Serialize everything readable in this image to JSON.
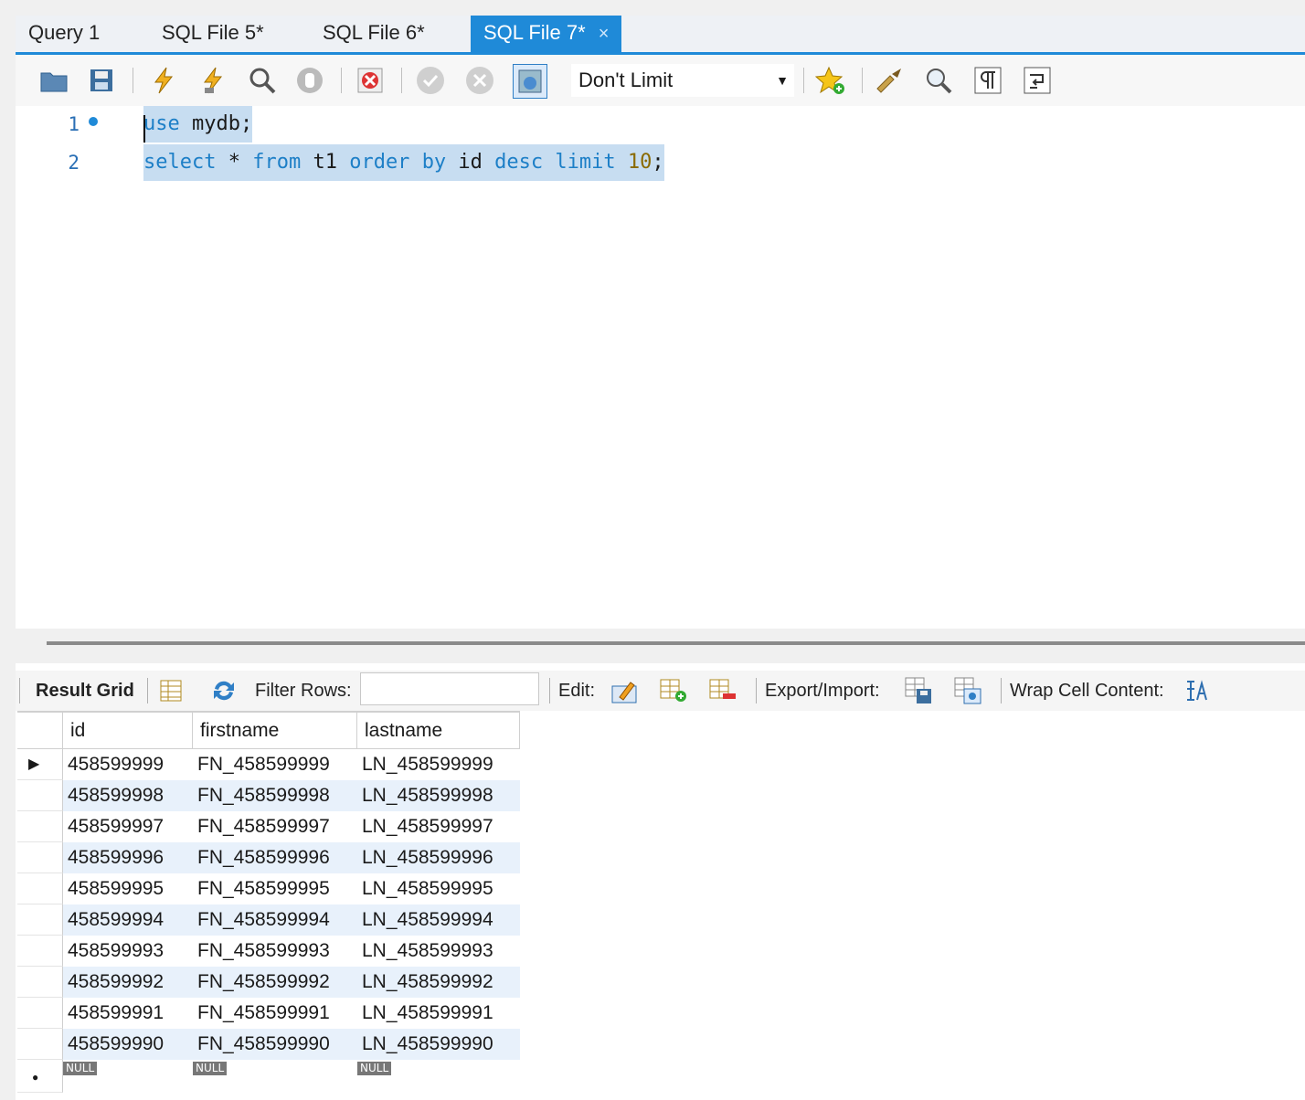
{
  "tabs": [
    {
      "label": "Query 1",
      "active": false
    },
    {
      "label": "SQL File 5*",
      "active": false
    },
    {
      "label": "SQL File 6*",
      "active": false
    },
    {
      "label": "SQL File 7*",
      "active": true
    }
  ],
  "tab_close": "×",
  "toolbar": {
    "limit_value": "Don't Limit",
    "icons": [
      "open-folder-icon",
      "save-icon",
      "execute-icon",
      "execute-current-icon",
      "explain-icon",
      "stop-icon",
      "toggle-error-icon",
      "commit-icon",
      "rollback-icon",
      "autocommit-icon",
      "add-snippet-icon",
      "beautify-icon",
      "find-icon",
      "invisible-chars-icon",
      "wrap-icon"
    ]
  },
  "editor": {
    "lines": [
      {
        "num": "1",
        "parts": [
          {
            "t": "use",
            "k": "kw"
          },
          {
            "t": " mydb;",
            "k": ""
          }
        ]
      },
      {
        "num": "2",
        "parts": [
          {
            "t": "select",
            "k": "kw"
          },
          {
            "t": " * ",
            "k": ""
          },
          {
            "t": "from",
            "k": "kw"
          },
          {
            "t": " t1 ",
            "k": ""
          },
          {
            "t": "order",
            "k": "kw"
          },
          {
            "t": " ",
            "k": ""
          },
          {
            "t": "by",
            "k": "kw"
          },
          {
            "t": " id ",
            "k": ""
          },
          {
            "t": "desc",
            "k": "kw"
          },
          {
            "t": " ",
            "k": ""
          },
          {
            "t": "limit",
            "k": "kw"
          },
          {
            "t": " ",
            "k": ""
          },
          {
            "t": "10",
            "k": "num"
          },
          {
            "t": ";",
            "k": ""
          }
        ]
      }
    ]
  },
  "result_toolbar": {
    "result_grid": "Result Grid",
    "filter_rows": "Filter Rows:",
    "filter_value": "",
    "edit": "Edit:",
    "export_import": "Export/Import:",
    "wrap_cell": "Wrap Cell Content:"
  },
  "grid": {
    "columns": [
      "id",
      "firstname",
      "lastname"
    ],
    "rows": [
      [
        "458599999",
        "FN_458599999",
        "LN_458599999"
      ],
      [
        "458599998",
        "FN_458599998",
        "LN_458599998"
      ],
      [
        "458599997",
        "FN_458599997",
        "LN_458599997"
      ],
      [
        "458599996",
        "FN_458599996",
        "LN_458599996"
      ],
      [
        "458599995",
        "FN_458599995",
        "LN_458599995"
      ],
      [
        "458599994",
        "FN_458599994",
        "LN_458599994"
      ],
      [
        "458599993",
        "FN_458599993",
        "LN_458599993"
      ],
      [
        "458599992",
        "FN_458599992",
        "LN_458599992"
      ],
      [
        "458599991",
        "FN_458599991",
        "LN_458599991"
      ],
      [
        "458599990",
        "FN_458599990",
        "LN_458599990"
      ]
    ],
    "null_label": "NULL",
    "current_row_marker": "▶",
    "new_row_marker": "●"
  },
  "colors": {
    "accent": "#1f8ad8",
    "selection": "#c7ddf1",
    "alt_row": "#e8f1fb"
  }
}
